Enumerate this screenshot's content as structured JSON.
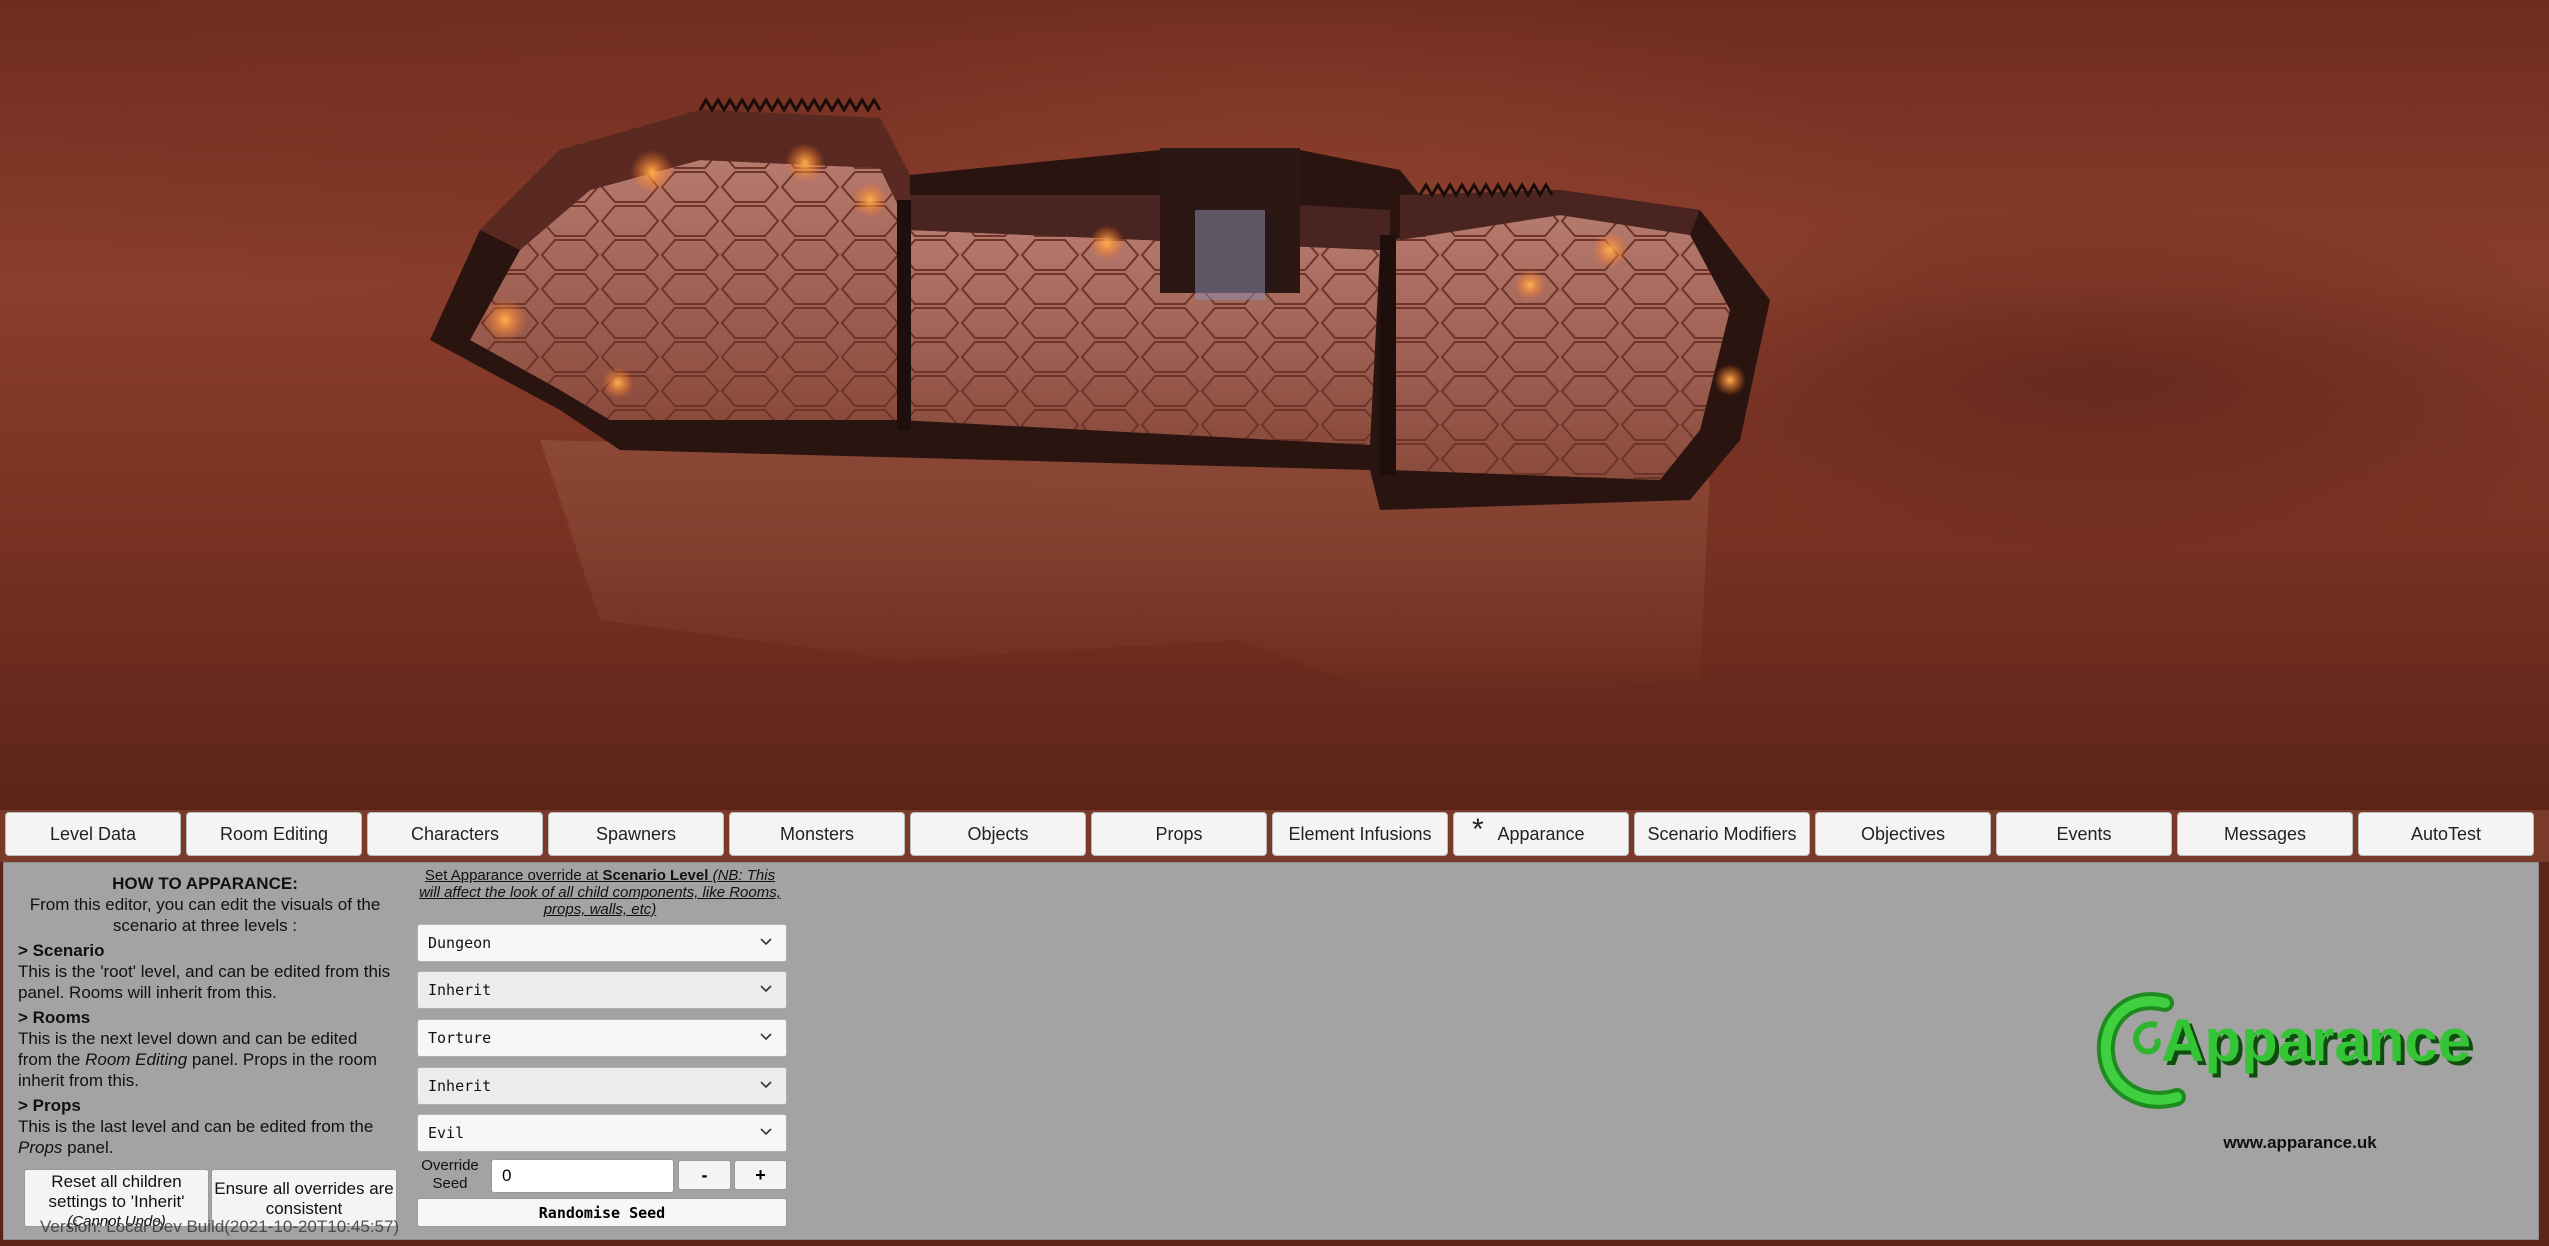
{
  "tabs": [
    {
      "label": "Level Data"
    },
    {
      "label": "Room Editing"
    },
    {
      "label": "Characters"
    },
    {
      "label": "Spawners"
    },
    {
      "label": "Monsters"
    },
    {
      "label": "Objects"
    },
    {
      "label": "Props"
    },
    {
      "label": "Element Infusions"
    },
    {
      "label": "Apparance",
      "marker": "*",
      "active": true
    },
    {
      "label": "Scenario Modifiers"
    },
    {
      "label": "Objectives"
    },
    {
      "label": "Events"
    },
    {
      "label": "Messages"
    },
    {
      "label": "AutoTest"
    }
  ],
  "howto": {
    "title": "HOW TO APPARANCE:",
    "intro": "From this editor, you can edit the visuals of the scenario at three levels :",
    "scenario_head": "> Scenario",
    "scenario_text": "This is the 'root' level, and can be edited from this panel. Rooms will inherit from this.",
    "rooms_head": "> Rooms",
    "rooms_text_a": "This is the next level down and can be edited from the ",
    "rooms_text_em": "Room Editing",
    "rooms_text_b": " panel. Props in the room inherit from this.",
    "props_head": "> Props",
    "props_text_a": "This is the last level and can be edited from the ",
    "props_text_em": "Props",
    "props_text_b": " panel."
  },
  "buttons": {
    "reset_line1": "Reset all children settings to 'Inherit'",
    "reset_line2": "(Cannot Undo)",
    "ensure": "Ensure all overrides are consistent"
  },
  "override": {
    "note_a": "Set Apparance override at ",
    "note_b": "Scenario Level",
    "note_c": " (NB: This will affect the look of all child components, like Rooms, props, walls, etc)",
    "selects": [
      "Dungeon",
      "Inherit",
      "Torture",
      "Inherit",
      "Evil"
    ],
    "seed_label": "Override Seed",
    "seed_value": "0",
    "minus": "-",
    "plus": "+",
    "randomise": "Randomise Seed"
  },
  "logo": {
    "name": "Apparance",
    "url": "www.apparance.uk"
  },
  "version": "Version: Local Dev Build(2021-10-20T10:45:57)",
  "colors": {
    "panel": "#a3a3a3",
    "logo_green": "#2db52d",
    "sky": "#8a3e2c"
  }
}
